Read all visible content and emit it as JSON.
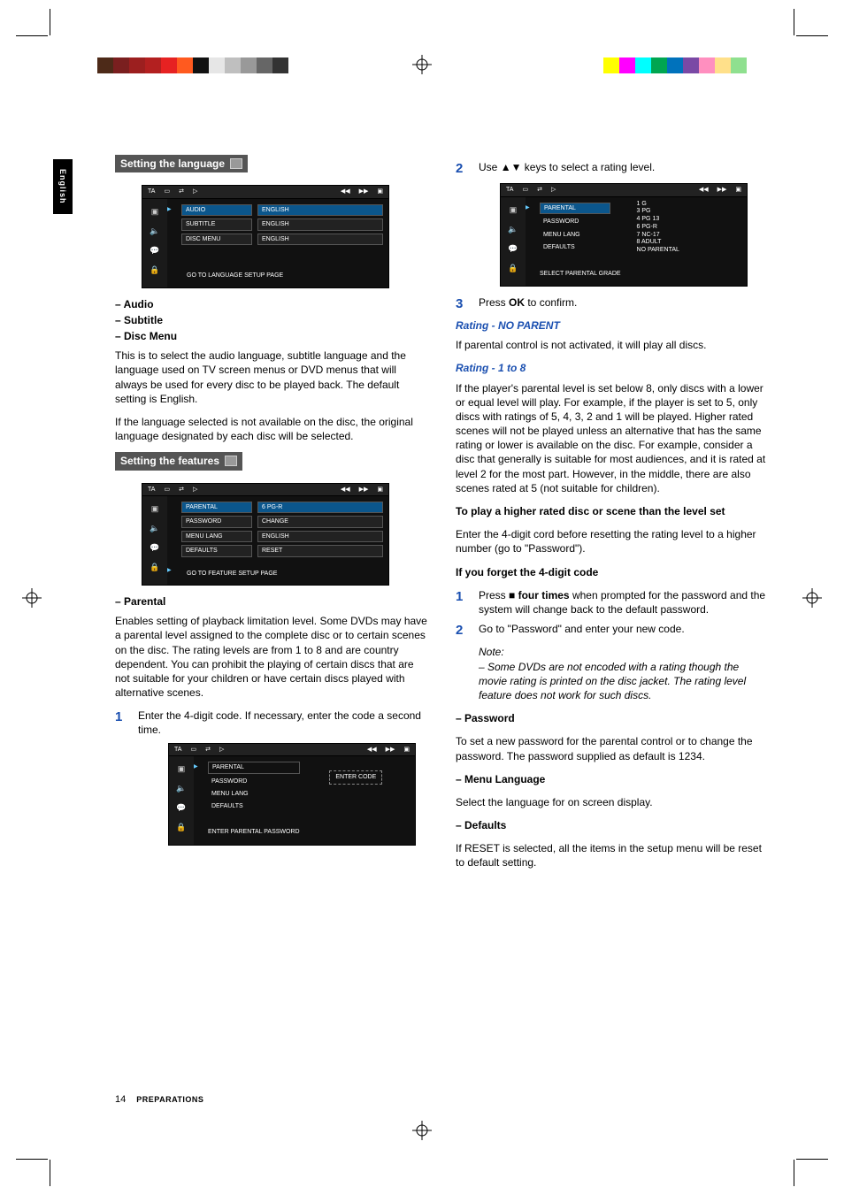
{
  "tab": "English",
  "footer": {
    "page": "14",
    "section": "PREPARATIONS"
  },
  "left": {
    "head1": "Setting the language",
    "osd1": {
      "label": "TA",
      "rows": [
        {
          "l": "AUDIO",
          "r": "ENGLISH",
          "hl": true
        },
        {
          "l": "SUBTITLE",
          "r": "ENGLISH"
        },
        {
          "l": "DISC MENU",
          "r": "ENGLISH"
        }
      ],
      "status": "GO TO LANGUAGE SETUP PAGE"
    },
    "list1": [
      "Audio",
      "Subtitle",
      "Disc Menu"
    ],
    "p1": "This is to select the audio language, subtitle language and the language used on TV screen menus or DVD menus that will always be used for every disc to be played back. The default setting is English.",
    "p2": "If the language selected is not available on the disc, the original language designated by each disc will be selected.",
    "head2": "Setting the features",
    "osd2": {
      "label": "TA",
      "rows": [
        {
          "l": "PARENTAL",
          "r": "6 PG-R",
          "hl": true
        },
        {
          "l": "PASSWORD",
          "r": "CHANGE"
        },
        {
          "l": "MENU LANG",
          "r": "ENGLISH"
        },
        {
          "l": "DEFAULTS",
          "r": "RESET"
        }
      ],
      "status": "GO TO FEATURE SETUP PAGE"
    },
    "list2": [
      "Parental"
    ],
    "p3": "Enables setting of playback limitation level. Some DVDs may have a parental level assigned to the complete disc or to certain scenes on the disc.  The rating levels are from 1 to 8 and are country dependent.  You can prohibit the playing of certain discs that are not suitable for your children or have certain discs played with alternative scenes.",
    "step1": {
      "n": "1",
      "t": "Enter the 4-digit code. If necessary, enter the code a second time."
    },
    "osd3": {
      "label": "TA",
      "rows": [
        {
          "l": "PARENTAL"
        },
        {
          "l": "PASSWORD"
        },
        {
          "l": "MENU LANG"
        },
        {
          "l": "DEFAULTS"
        }
      ],
      "entry": "ENTER CODE",
      "status": "ENTER PARENTAL PASSWORD"
    }
  },
  "right": {
    "step2": {
      "n": "2",
      "t1": "Use ",
      "t2": " keys to select a rating level."
    },
    "arrows": "▲▼",
    "osd4": {
      "label": "TA",
      "rows": [
        {
          "l": "PARENTAL"
        },
        {
          "l": "PASSWORD"
        },
        {
          "l": "MENU LANG"
        },
        {
          "l": "DEFAULTS"
        }
      ],
      "ratings": "1 G\n3 PG\n4 PG 13\n6 PG-R\n7 NC-17\n8 ADULT\nNO PARENTAL",
      "status": "SELECT PARENTAL GRADE"
    },
    "step3": {
      "n": "3",
      "t1": "Press ",
      "ok": "OK",
      "t2": " to confirm."
    },
    "h1": "Rating - NO PARENT",
    "p1": "If parental control is not activated, it will play all discs.",
    "h2": "Rating - 1 to 8",
    "p2": "If the player's parental level is set below 8, only discs with a lower or equal level will play. For example, if the player is set to 5, only discs with ratings of 5, 4, 3, 2 and 1 will be played.  Higher rated scenes will not be played unless an alternative that has the same rating or lower is available on the disc. For example, consider a disc that generally is suitable for most audiences, and it is rated at level 2 for the most part. However, in the middle, there are also scenes rated at 5 (not suitable for children).",
    "h3": "To play a higher rated disc or scene than the level set",
    "p3": "Enter the 4-digit cord before resetting the rating level to a higher number (go to \"Password\").",
    "h4": "If you forget the 4-digit code",
    "step4": {
      "n": "1",
      "t1": "Press ",
      "sym": "■",
      "bold": " four times",
      "t2": " when prompted for the password and the system will change back to the default password."
    },
    "step5": {
      "n": "2",
      "t": "Go to \"Password\" and enter your new code."
    },
    "noteLabel": "Note:",
    "noteBody": "–   Some DVDs are not encoded with a rating though the movie rating is printed on the disc jacket.  The rating level feature does not work for such discs.",
    "h5": "–   Password",
    "p5": "To set a new password for the parental control or to change the password.  The password supplied as default is 1234.",
    "h6": "–   Menu Language",
    "p6": "Select the language for on screen display.",
    "h7": "–   Defaults",
    "p7": "If RESET is selected, all the items in the setup menu will be reset to default setting."
  },
  "colorbars": {
    "left": [
      "#4d2a18",
      "#7a1f1f",
      "#9c1f1f",
      "#b32020",
      "#e62222",
      "#ff5a1f",
      "#111",
      "#e6e6e6",
      "#bfbfbf",
      "#999",
      "#666",
      "#333"
    ],
    "right": [
      "#ffff00",
      "#ff00ff",
      "#00ffff",
      "#00a651",
      "#0072bc",
      "#7a49a5",
      "#ff8fbf",
      "#ffe08a",
      "#8fe08f"
    ]
  }
}
